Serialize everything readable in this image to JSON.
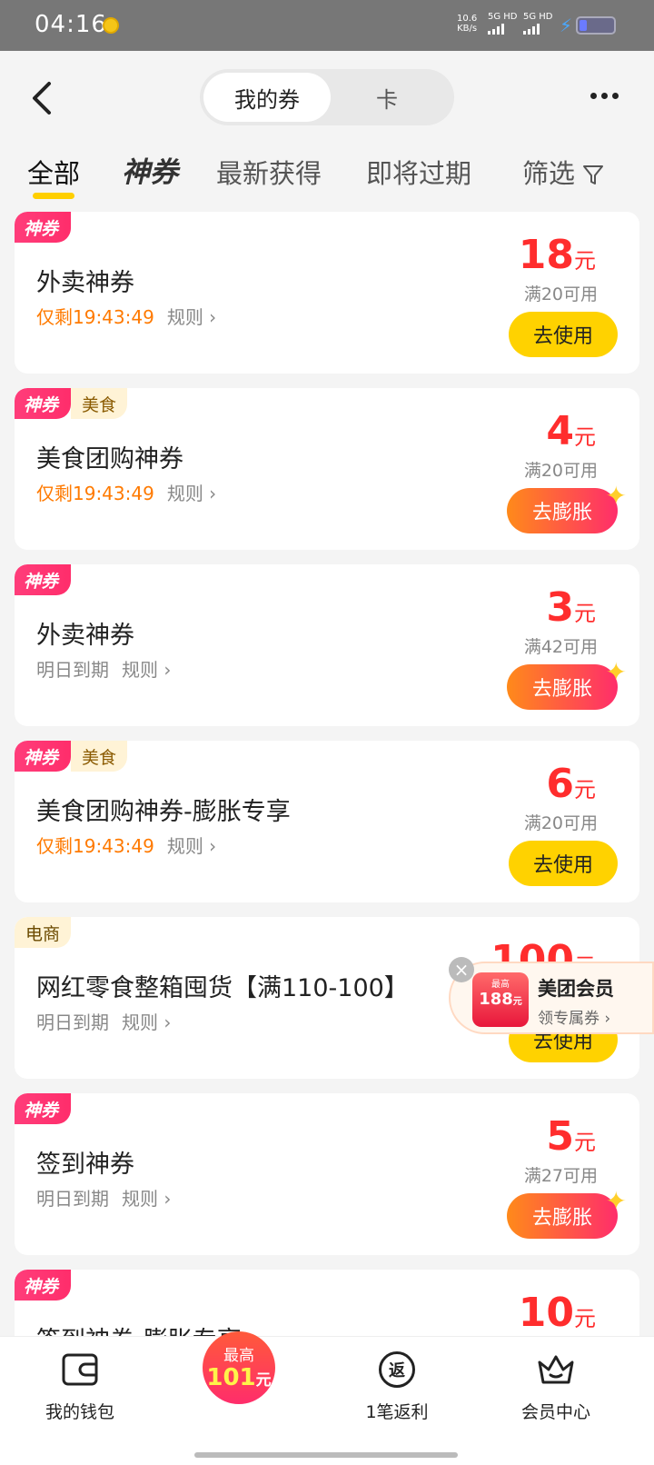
{
  "status_bar": {
    "time": "04:16",
    "net_speed": "10.6",
    "net_unit": "KB/s",
    "sig1": "5G HD",
    "sig2": "5G HD"
  },
  "header": {
    "segments": [
      "我的券",
      "卡"
    ]
  },
  "tabs": [
    "全部",
    "神券",
    "最新获得",
    "即将过期",
    "筛选"
  ],
  "coupons": [
    {
      "tags": [
        "神券"
      ],
      "title": "外卖神券",
      "expiry": "仅剩19:43:49",
      "rule": "规则 ›",
      "amount": "18",
      "unit": "元",
      "cond": "满20可用",
      "action": "去使用"
    },
    {
      "tags": [
        "神券",
        "美食"
      ],
      "title": "美食团购神券",
      "expiry": "仅剩19:43:49",
      "rule": "规则 ›",
      "amount": "4",
      "unit": "元",
      "cond": "满20可用",
      "action": "去膨胀"
    },
    {
      "tags": [
        "神券"
      ],
      "title": "外卖神券",
      "expiry": "明日到期",
      "rule": "规则 ›",
      "amount": "3",
      "unit": "元",
      "cond": "满42可用",
      "action": "去膨胀"
    },
    {
      "tags": [
        "神券",
        "美食"
      ],
      "title": "美食团购神券-膨胀专享",
      "expiry": "仅剩19:43:49",
      "rule": "规则 ›",
      "amount": "6",
      "unit": "元",
      "cond": "满20可用",
      "action": "去使用"
    },
    {
      "tags": [
        "电商"
      ],
      "title": "网红零食整箱囤货【满110-100】",
      "expiry": "明日到期",
      "rule": "规则 ›",
      "amount": "100",
      "unit": "元",
      "cond": "",
      "action": "去使用"
    },
    {
      "tags": [
        "神券"
      ],
      "title": "签到神券",
      "expiry": "明日到期",
      "rule": "规则 ›",
      "amount": "5",
      "unit": "元",
      "cond": "满27可用",
      "action": "去膨胀"
    },
    {
      "tags": [
        "神券"
      ],
      "title": "签到神券-膨胀专享",
      "expiry": "",
      "rule": "",
      "amount": "10",
      "unit": "元",
      "cond": "",
      "action": ""
    }
  ],
  "member_badge": {
    "gift_top": "最高",
    "gift_amount": "188",
    "gift_unit": "元",
    "title": "美团会员",
    "subtitle": "领专属券 ›"
  },
  "bottom_bar": {
    "wallet": "我的钱包",
    "center_top": "最高",
    "center_amount": "101",
    "center_unit": "元",
    "rebate": "1笔返利",
    "rebate_icon": "返",
    "member": "会员中心"
  },
  "colors": {
    "accent_yellow": "#ffd200",
    "price_red": "#ff2d2d",
    "expiry_orange": "#ff7a00",
    "brand_pink": "#ff2d6b"
  }
}
